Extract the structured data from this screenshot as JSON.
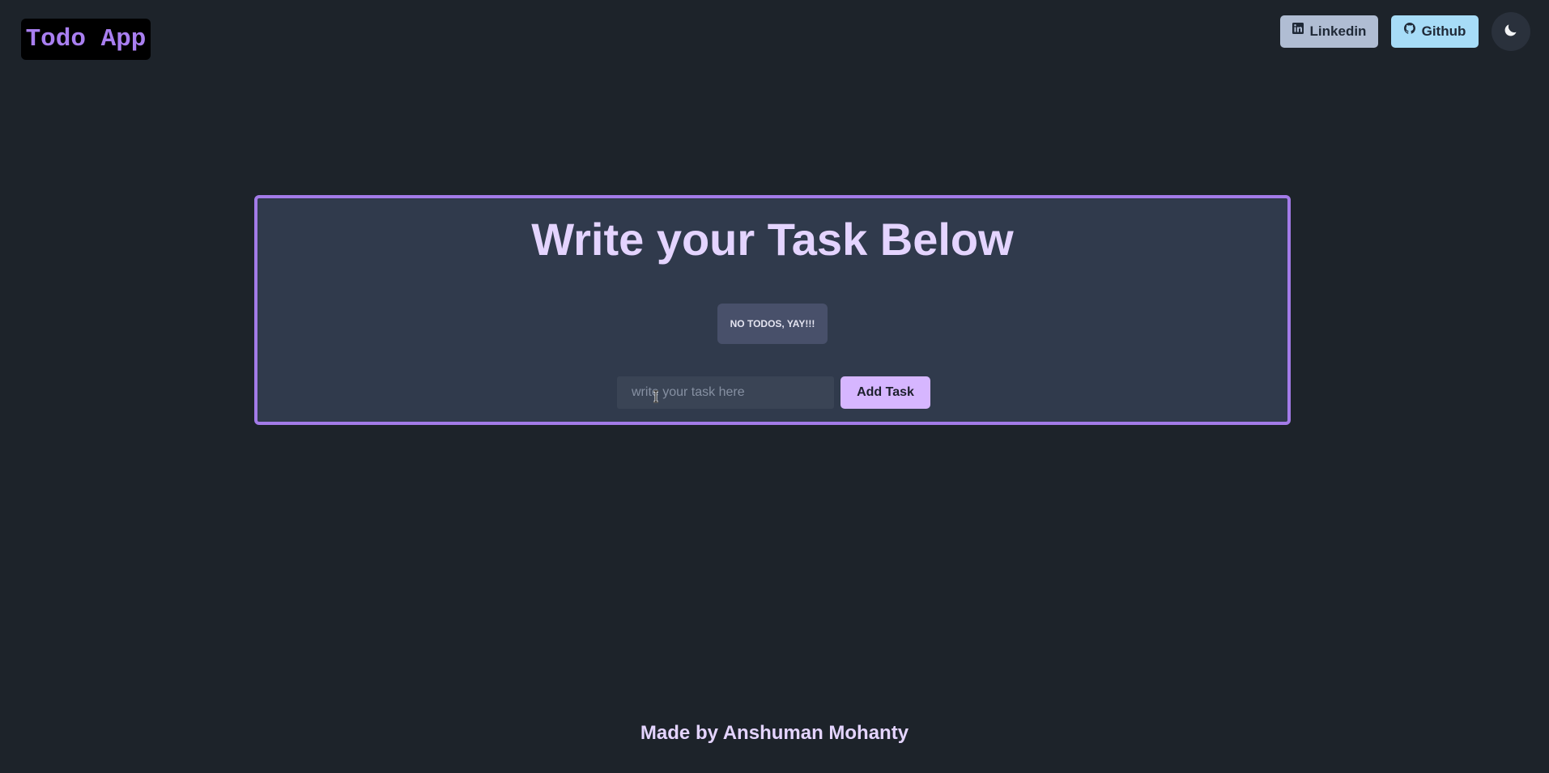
{
  "header": {
    "logo_text": "Todo App",
    "linkedin_label": "Linkedin",
    "github_label": "Github",
    "theme_toggle_icon": "moon-icon"
  },
  "main": {
    "title": "Write your Task Below",
    "empty_message": "NO TODOS, YAY!!!",
    "input": {
      "value": "",
      "placeholder": "write your task here"
    },
    "add_button_label": "Add Task"
  },
  "footer": {
    "text": "Made by Anshuman Mohanty"
  },
  "colors": {
    "background": "#1d232a",
    "card_border": "#a37be8",
    "card_background": "#303a4c",
    "accent_button": "#d6b6ff",
    "logo_text": "#a97ff0",
    "linkedin_button": "#b0bdd3",
    "github_button": "#a7dcf7"
  }
}
